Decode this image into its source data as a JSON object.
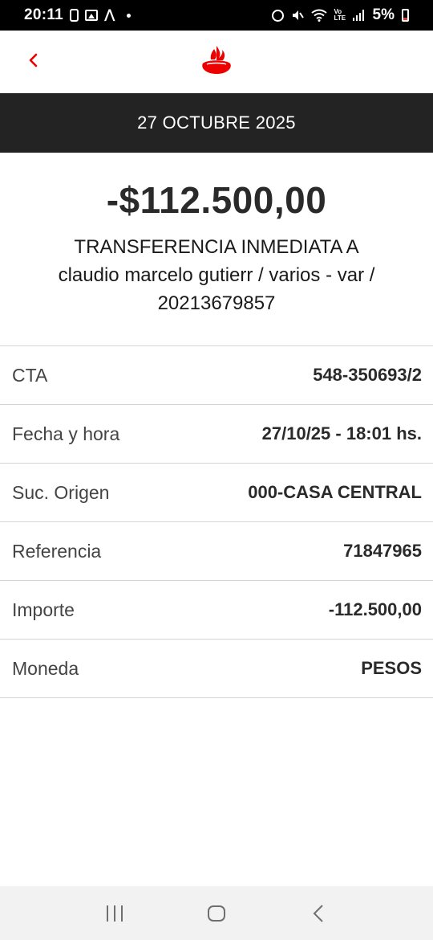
{
  "status_bar": {
    "time": "20:11",
    "battery_percent": "5%",
    "network_label": "Vo LTE"
  },
  "header": {
    "back_icon": "chevron-left-icon",
    "logo_icon": "santander-flame-logo",
    "brand_color": "#ec0000"
  },
  "date_band": {
    "label": "27 OCTUBRE 2025"
  },
  "transaction": {
    "amount": "-$112.500,00",
    "description_line1": "TRANSFERENCIA INMEDIATA A",
    "description_line2": "claudio marcelo gutierr / varios - var /",
    "description_line3": "20213679857"
  },
  "details": [
    {
      "label": "CTA",
      "value": "548-350693/2"
    },
    {
      "label": "Fecha y hora",
      "value": "27/10/25 - 18:01 hs."
    },
    {
      "label": "Suc. Origen",
      "value": "000-CASA CENTRAL"
    },
    {
      "label": "Referencia",
      "value": "71847965"
    },
    {
      "label": "Importe",
      "value": "-112.500,00"
    },
    {
      "label": "Moneda",
      "value": "PESOS"
    }
  ],
  "nav_bar": {
    "recents_icon": "recents-icon",
    "home_icon": "home-icon",
    "back_icon": "back-icon"
  }
}
